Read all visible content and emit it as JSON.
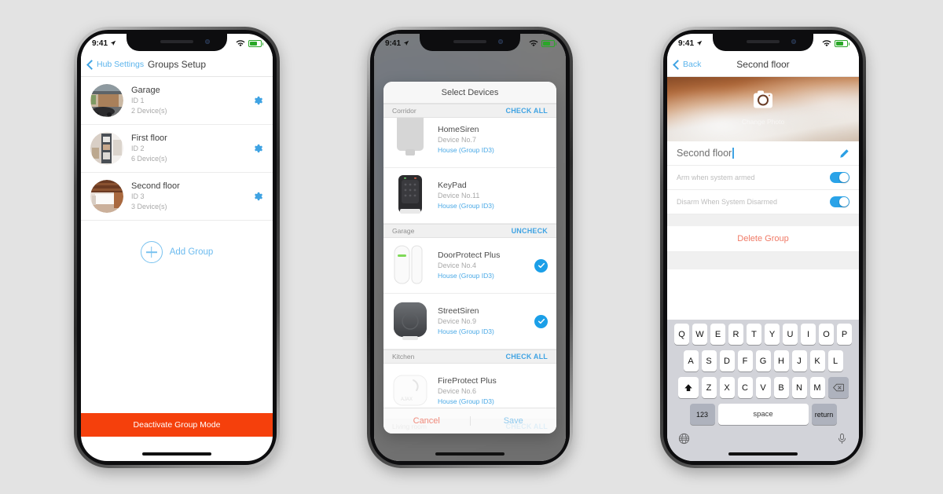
{
  "theme": {
    "page_bg": "#e3e3e3",
    "accent_blue": "#3fa3e3",
    "light_blue": "#6cbbef",
    "orange": "#f5400c",
    "red": "#f07a66"
  },
  "status_bar": {
    "time": "9:41",
    "location_icon": "location-arrow-icon",
    "wifi_icon": "wifi-icon",
    "battery_icon": "battery-icon"
  },
  "phone1": {
    "nav": {
      "back_label": "Hub Settings",
      "title": "Groups Setup",
      "back_icon": "chevron-left-icon"
    },
    "groups": [
      {
        "name": "Garage",
        "id": "ID 1",
        "devices": "2 Device(s)",
        "gear_icon": "gear-icon"
      },
      {
        "name": "First floor",
        "id": "ID 2",
        "devices": "6 Device(s)",
        "gear_icon": "gear-icon"
      },
      {
        "name": "Second floor",
        "id": "ID 3",
        "devices": "3 Device(s)",
        "gear_icon": "gear-icon"
      }
    ],
    "add_group": {
      "label": "Add Group",
      "icon": "plus-circle-icon"
    },
    "bottom_action": {
      "label": "Deactivate Group Mode"
    }
  },
  "phone2": {
    "modal": {
      "title": "Select Devices",
      "sections": [
        {
          "name": "Corridor",
          "action": "CHECK ALL",
          "devices": [
            {
              "name": "HomeSiren",
              "number": "Device No.7",
              "group": "House (Group ID3)",
              "checked": false
            }
          ]
        },
        {
          "name": "",
          "action": "",
          "devices": [
            {
              "name": "KeyPad",
              "number": "Device No.11",
              "group": "House (Group ID3)",
              "checked": false
            }
          ]
        },
        {
          "name": "Garage",
          "action": "UNCHECK",
          "devices": [
            {
              "name": "DoorProtect Plus",
              "number": "Device No.4",
              "group": "House (Group ID3)",
              "checked": true
            },
            {
              "name": "StreetSiren",
              "number": "Device No.9",
              "group": "House (Group ID3)",
              "checked": true
            }
          ]
        },
        {
          "name": "Kitchen",
          "action": "CHECK ALL",
          "devices": [
            {
              "name": "FireProtect Plus",
              "number": "Device No.6",
              "group": "House (Group ID3)",
              "checked": false
            }
          ]
        },
        {
          "name": "Living room",
          "action": "CHECK ALL",
          "devices": []
        }
      ],
      "footer": {
        "cancel": "Cancel",
        "save": "Save"
      }
    }
  },
  "phone3": {
    "nav": {
      "back_label": "Back",
      "title": "Second floor",
      "back_icon": "chevron-left-icon"
    },
    "hero": {
      "camera_icon": "camera-icon",
      "label": "Change Photo"
    },
    "name_field": {
      "value": "Second floor",
      "edit_icon": "pencil-icon"
    },
    "toggles": [
      {
        "label": "Arm when system armed",
        "on": true
      },
      {
        "label": "Disarm When System Disarmed",
        "on": true
      }
    ],
    "delete_action": {
      "label": "Delete Group"
    },
    "keyboard": {
      "row1": [
        "Q",
        "W",
        "E",
        "R",
        "T",
        "Y",
        "U",
        "I",
        "O",
        "P"
      ],
      "row2": [
        "A",
        "S",
        "D",
        "F",
        "G",
        "H",
        "J",
        "K",
        "L"
      ],
      "row3": [
        "Z",
        "X",
        "C",
        "V",
        "B",
        "N",
        "M"
      ],
      "shift_icon": "shift-icon",
      "delete_icon": "backspace-icon",
      "numeric_key": "123",
      "space_key": "space",
      "return_key": "return",
      "globe_icon": "globe-icon",
      "mic_icon": "microphone-icon"
    }
  }
}
